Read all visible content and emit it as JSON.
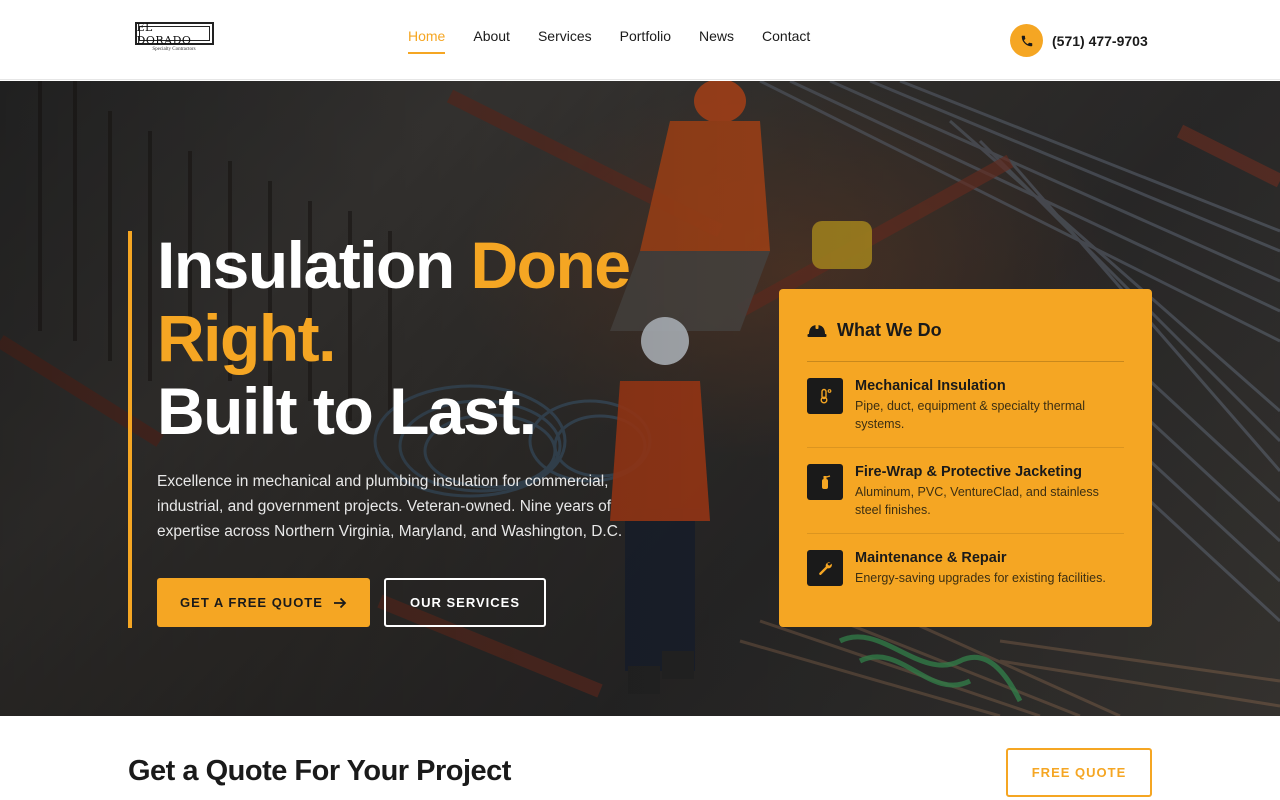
{
  "brand": {
    "logo_text": "EL DORADO",
    "logo_subtext": "Specialty Contractors"
  },
  "nav": {
    "items": [
      {
        "label": "Home",
        "active": true
      },
      {
        "label": "About",
        "active": false
      },
      {
        "label": "Services",
        "active": false
      },
      {
        "label": "Portfolio",
        "active": false
      },
      {
        "label": "News",
        "active": false
      },
      {
        "label": "Contact",
        "active": false
      }
    ]
  },
  "header": {
    "phone": "(571) 477-9703",
    "phone_icon": "phone-icon"
  },
  "hero": {
    "title_line1_white": "Insulation ",
    "title_line1_accent": "Done",
    "title_line2_accent": "Right.",
    "title_line3_white": "Built to Last.",
    "description": "Excellence in mechanical and plumbing insulation for commercial, industrial, and government projects. Veteran-owned. Nine years of expertise across Northern Virginia, Maryland, and Washington, D.C.",
    "primary_button": "GET A FREE QUOTE",
    "secondary_button": "OUR SERVICES"
  },
  "card": {
    "title": "What We Do",
    "icon": "hard-hat-icon",
    "services": [
      {
        "name": "Mechanical Insulation",
        "desc": "Pipe, duct, equipment & specialty thermal systems.",
        "icon": "thermometer-icon"
      },
      {
        "name": "Fire-Wrap & Protective Jacketing",
        "desc": "Aluminum, PVC, VentureClad, and stainless steel finishes.",
        "icon": "fire-extinguisher-icon"
      },
      {
        "name": "Maintenance & Repair",
        "desc": "Energy-saving upgrades for existing facilities.",
        "icon": "wrench-icon"
      }
    ]
  },
  "cta": {
    "title": "Get a Quote For Your Project",
    "button": "FREE QUOTE"
  },
  "colors": {
    "accent": "#f5a623",
    "dark": "#1a1a1a",
    "white": "#ffffff"
  }
}
